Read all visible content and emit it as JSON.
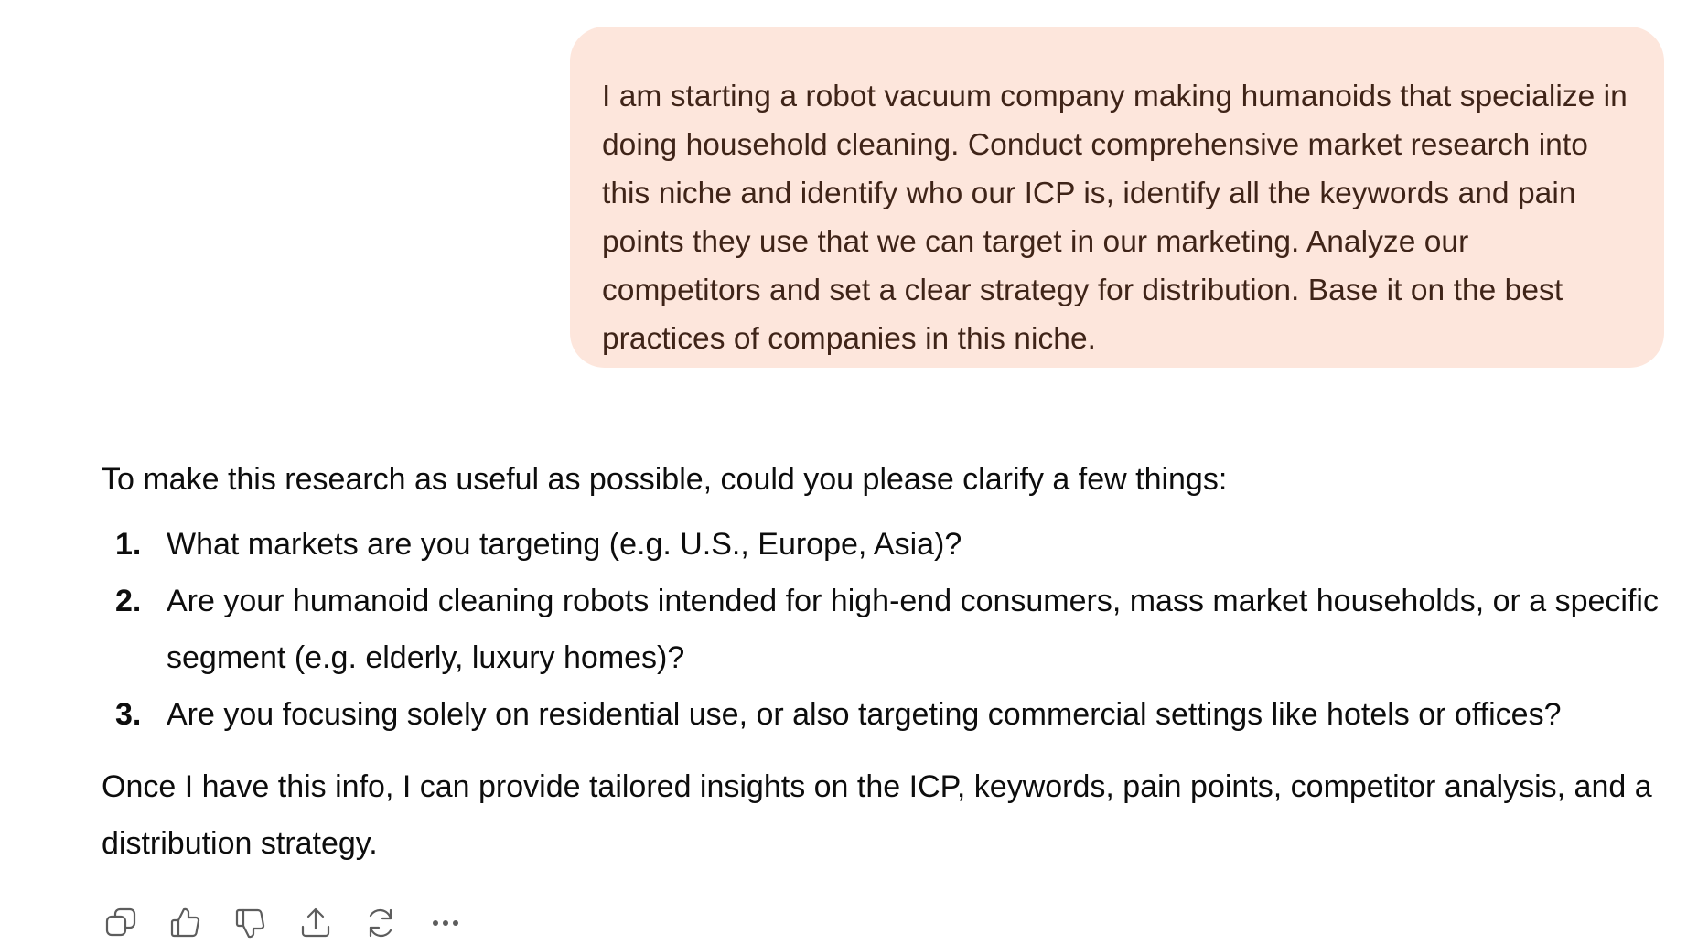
{
  "user_message": {
    "text": "I am starting a robot vacuum company making humanoids that specialize in doing household cleaning. Conduct comprehensive market research into this niche and identify who our ICP is, identify all the keywords and pain points they use that we can target in our marketing. Analyze our competitors and set a clear strategy for distribution. Base it on the best practices of companies in this niche."
  },
  "assistant_message": {
    "intro": "To make this research as useful as possible, could you please clarify a few things:",
    "questions": [
      {
        "number": "1.",
        "text": "What markets are you targeting (e.g. U.S., Europe, Asia)?"
      },
      {
        "number": "2.",
        "text": "Are your humanoid cleaning robots intended for high-end consumers, mass market households, or a specific segment (e.g. elderly, luxury homes)?"
      },
      {
        "number": "3.",
        "text": "Are you focusing solely on residential use, or also targeting commercial settings like hotels or offices?"
      }
    ],
    "outro": "Once I have this info, I can provide tailored insights on the ICP, keywords, pain points, competitor analysis, and a distribution strategy."
  },
  "action_bar": {
    "icons": [
      "copy-icon",
      "thumbs-up-icon",
      "thumbs-down-icon",
      "share-icon",
      "regenerate-icon",
      "more-icon"
    ]
  },
  "colors": {
    "user_bubble_bg": "#fde6dc",
    "user_bubble_text": "#3f2418",
    "assistant_text": "#0d0d0d",
    "icon": "#5d5d5d"
  }
}
